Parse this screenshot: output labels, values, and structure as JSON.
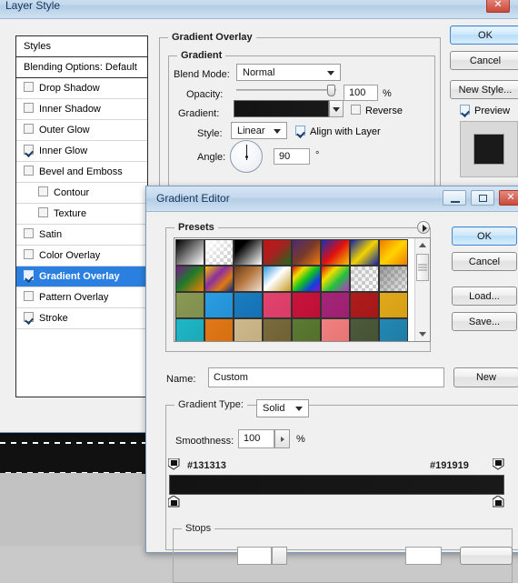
{
  "desktop": {
    "ghost_text": "Pattern Overlay"
  },
  "layer_style": {
    "title": "Layer Style",
    "window_buttons": {
      "close": "✕"
    },
    "styles_list": {
      "header": "Styles",
      "items": [
        {
          "label": "Blending Options: Default",
          "checkbox": false,
          "has_checkbox": false,
          "indent": false,
          "selected": false
        },
        {
          "label": "Drop Shadow",
          "checkbox": false,
          "has_checkbox": true,
          "indent": false,
          "selected": false
        },
        {
          "label": "Inner Shadow",
          "checkbox": false,
          "has_checkbox": true,
          "indent": false,
          "selected": false
        },
        {
          "label": "Outer Glow",
          "checkbox": false,
          "has_checkbox": true,
          "indent": false,
          "selected": false
        },
        {
          "label": "Inner Glow",
          "checkbox": true,
          "has_checkbox": true,
          "indent": false,
          "selected": false
        },
        {
          "label": "Bevel and Emboss",
          "checkbox": false,
          "has_checkbox": true,
          "indent": false,
          "selected": false
        },
        {
          "label": "Contour",
          "checkbox": false,
          "has_checkbox": true,
          "indent": true,
          "selected": false
        },
        {
          "label": "Texture",
          "checkbox": false,
          "has_checkbox": true,
          "indent": true,
          "selected": false
        },
        {
          "label": "Satin",
          "checkbox": false,
          "has_checkbox": true,
          "indent": false,
          "selected": false
        },
        {
          "label": "Color Overlay",
          "checkbox": false,
          "has_checkbox": true,
          "indent": false,
          "selected": false
        },
        {
          "label": "Gradient Overlay",
          "checkbox": true,
          "has_checkbox": true,
          "indent": false,
          "selected": true
        },
        {
          "label": "Pattern Overlay",
          "checkbox": false,
          "has_checkbox": true,
          "indent": false,
          "selected": false
        },
        {
          "label": "Stroke",
          "checkbox": true,
          "has_checkbox": true,
          "indent": false,
          "selected": false
        }
      ]
    },
    "panel": {
      "group_title": "Gradient Overlay",
      "subgroup_title": "Gradient",
      "blend_mode_label": "Blend Mode:",
      "blend_mode_value": "Normal",
      "opacity_label": "Opacity:",
      "opacity_value": "100",
      "opacity_unit": "%",
      "gradient_label": "Gradient:",
      "gradient_from": "#131313",
      "gradient_to": "#191919",
      "reverse_label": "Reverse",
      "reverse_checked": false,
      "style_label": "Style:",
      "style_value": "Linear",
      "align_label": "Align with Layer",
      "align_checked": true,
      "angle_label": "Angle:",
      "angle_value": "90",
      "angle_unit": "°"
    },
    "buttons": {
      "ok": "OK",
      "cancel": "Cancel",
      "new_style": "New Style...",
      "preview_label": "Preview",
      "preview_checked": true,
      "preview_swatch_color": "#1a1a1a"
    }
  },
  "gradient_editor": {
    "title": "Gradient Editor",
    "window_buttons": {
      "minimize": "–",
      "maximize": "□",
      "close": "✕"
    },
    "presets_label": "Presets",
    "presets": [
      {
        "name": "foreground-to-background",
        "css": "linear-gradient(135deg,#000000 0%,#4a4a4a 30%,#ffffff 100%)"
      },
      {
        "name": "foreground-to-transparent",
        "css": "linear-gradient(135deg,#ffffff 0%,rgba(255,255,255,0) 100%)",
        "checker": true
      },
      {
        "name": "black-white",
        "css": "linear-gradient(135deg,#000000 0%,#000000 25%,#ffffff 100%)"
      },
      {
        "name": "red-green",
        "css": "linear-gradient(135deg,#c01414 0%,#a82020 45%,#1c6b1c 100%)"
      },
      {
        "name": "violet-orange",
        "css": "linear-gradient(135deg,#4b2a74 0%,#7a3a2a 50%,#f07c10 100%)"
      },
      {
        "name": "blue-red-yellow",
        "css": "linear-gradient(135deg,#1a2fb0 0%,#e01010 50%,#f5c400 100%)"
      },
      {
        "name": "blue-yellow-blue",
        "css": "linear-gradient(135deg,#1022a8 0%,#f2d400 50%,#1022a8 100%)"
      },
      {
        "name": "orange-yellow-orange",
        "css": "linear-gradient(135deg,#f07a00 0%,#ffd400 50%,#f07a00 100%)"
      },
      {
        "name": "violet-green-orange",
        "css": "linear-gradient(135deg,#7a1a8c 0%,#1e7a2a 45%,#f08000 100%)"
      },
      {
        "name": "yellow-violet-orange-blue",
        "css": "linear-gradient(135deg,#f5c000 0%,#8a2fa0 40%,#e07a10 70%,#102a8c 100%)"
      },
      {
        "name": "copper",
        "css": "linear-gradient(135deg,#6b3a18 0%,#b5763f 45%,#f0ded0 100%)"
      },
      {
        "name": "chrome",
        "css": "linear-gradient(135deg,#2e9ae0 0%,#ffffff 45%,#c89a20 100%)"
      },
      {
        "name": "spectrum",
        "css": "linear-gradient(135deg,#e01010 0%,#f0e000 25%,#10c020 50%,#1040e0 75%,#9010c0 100%)"
      },
      {
        "name": "transparent-rainbow",
        "css": "linear-gradient(135deg,#e01010 0%,#f0e000 30%,#20c040 60%,#c030d0 100%)",
        "checker": true
      },
      {
        "name": "transparent-stripes",
        "css": "linear-gradient(135deg,rgba(200,200,200,.45) 0%,rgba(255,255,255,.1) 100%)",
        "checker": true
      },
      {
        "name": "neutral-density",
        "css": "linear-gradient(135deg,rgba(120,120,120,.75) 0%,rgba(190,190,190,.3) 100%)",
        "checker": true
      },
      {
        "name": "olive-solid",
        "css": "linear-gradient(135deg,#8a9a55 0%,#7f8f4c 100%)"
      },
      {
        "name": "sky-blue-solid",
        "css": "linear-gradient(135deg,#2b9ee0 0%,#2390d6 100%)"
      },
      {
        "name": "deep-blue-solid",
        "css": "linear-gradient(135deg,#1a7ec0 0%,#1470b4 100%)"
      },
      {
        "name": "pink-solid",
        "css": "linear-gradient(135deg,#e0456e 0%,#d93b66 100%)"
      },
      {
        "name": "crimson-solid",
        "css": "linear-gradient(135deg,#c8143c 0%,#bd1036 100%)"
      },
      {
        "name": "magenta-solid",
        "css": "linear-gradient(135deg,#a52578 0%,#9c2070 100%)"
      },
      {
        "name": "dark-red-solid",
        "css": "linear-gradient(135deg,#b01c1c 0%,#a41818 100%)"
      },
      {
        "name": "gold-solid",
        "css": "linear-gradient(135deg,#e0a81c 0%,#d69f14 100%)"
      },
      {
        "name": "teal-solid",
        "css": "linear-gradient(135deg,#1fb8c8 0%,#1aa8b8 100%)"
      },
      {
        "name": "orange-solid",
        "css": "linear-gradient(135deg,#e07818 0%,#d66f10 100%)"
      },
      {
        "name": "tan-solid",
        "css": "linear-gradient(135deg,#cdb88c 0%,#c4ae80 100%)"
      },
      {
        "name": "khaki-solid",
        "css": "linear-gradient(135deg,#7a6b3c 0%,#6f6134 100%)"
      },
      {
        "name": "moss-solid",
        "css": "linear-gradient(135deg,#5c7a33 0%,#54702c 100%)"
      },
      {
        "name": "salmon-solid",
        "css": "linear-gradient(135deg,#f08080 0%,#e87474 100%)"
      },
      {
        "name": "dark-olive-solid",
        "css": "linear-gradient(135deg,#4e5a3c 0%,#465234 100%)"
      },
      {
        "name": "steel-blue-solid",
        "css": "linear-gradient(135deg,#2288b4 0%,#1e7ca6 100%)"
      }
    ],
    "name_label": "Name:",
    "name_value": "Custom",
    "new_button": "New",
    "gradient_type_label": "Gradient Type:",
    "gradient_type_value": "Solid",
    "smoothness_label": "Smoothness:",
    "smoothness_value": "100",
    "smoothness_unit": "%",
    "gradient_bar": {
      "left_hex": "#131313",
      "right_hex": "#191919",
      "left_color": "#131313",
      "right_color": "#191919"
    },
    "stops_label": "Stops",
    "buttons": {
      "ok": "OK",
      "cancel": "Cancel",
      "load": "Load...",
      "save": "Save..."
    }
  }
}
